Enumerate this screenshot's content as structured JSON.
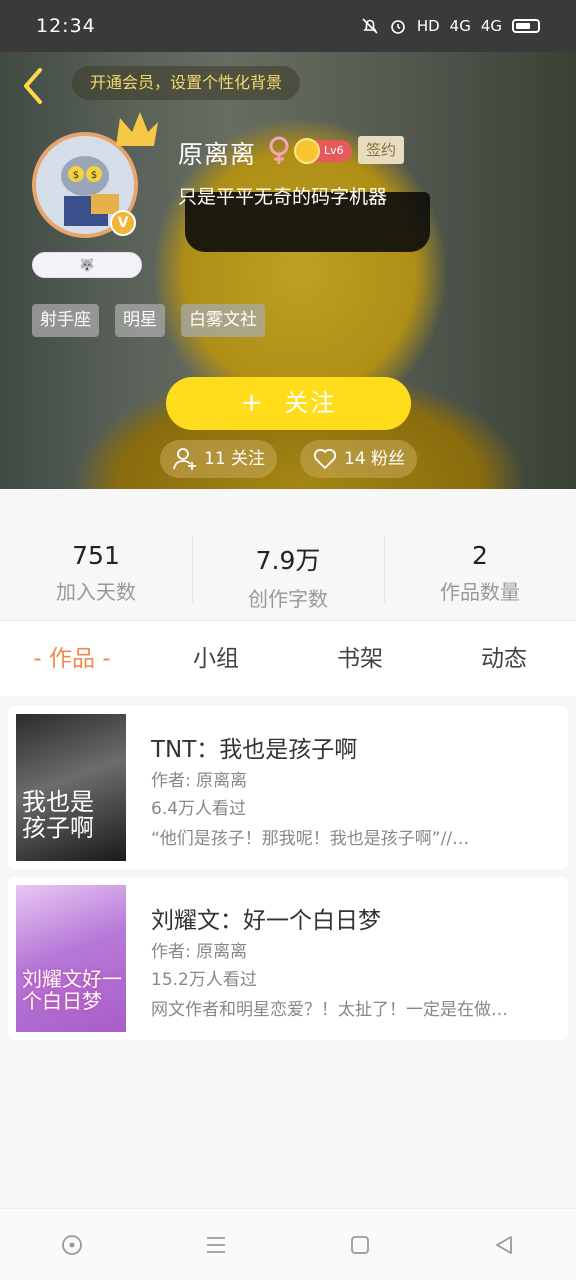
{
  "status_bar": {
    "time": "12:34",
    "network": "HD",
    "signal1": "4G",
    "signal2": "4G"
  },
  "header": {
    "vip_tip": "开通会员，设置个性化背景"
  },
  "profile": {
    "name": "原离离",
    "level": "Lv6",
    "sign_badge": "签约",
    "bio": "只是平平无奇的码字机器",
    "verified_badge": "V",
    "tags": [
      "射手座",
      "明星",
      "白雾文社"
    ],
    "follow_button": {
      "plus": "+",
      "label": "关注"
    },
    "following": "11 关注",
    "fans": "14 粉丝"
  },
  "stats": [
    {
      "value": "751",
      "label": "加入天数"
    },
    {
      "value": "7.9万",
      "label": "创作字数"
    },
    {
      "value": "2",
      "label": "作品数量"
    }
  ],
  "tabs": [
    "- 作品 -",
    "小组",
    "书架",
    "动态"
  ],
  "books": [
    {
      "title": "TNT：我也是孩子啊",
      "author": "作者: 原离离",
      "views": "6.4万人看过",
      "desc": "“他们是孩子！那我呢！我也是孩子啊”//…",
      "cover_text": "我也是孩子啊"
    },
    {
      "title": "刘耀文：好一个白日梦",
      "author": "作者: 原离离",
      "views": "15.2万人看过",
      "desc": "网文作者和明星恋爱？！太扯了！一定是在做…",
      "cover_text": "刘耀文好一个白日梦"
    }
  ],
  "colors": {
    "accent": "#f08b4e",
    "follow": "#ffdc1c",
    "avatar_border": "#e7a56b"
  }
}
